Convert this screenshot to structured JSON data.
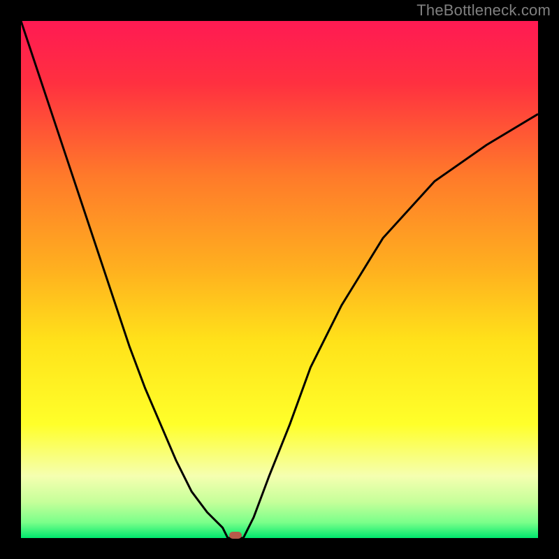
{
  "watermark": "TheBottleneck.com",
  "colors": {
    "frame": "#000000",
    "marker": "#b85a4a",
    "curve": "#000000",
    "gradient_stops": [
      {
        "offset": 0.0,
        "color": "#ff1a53"
      },
      {
        "offset": 0.12,
        "color": "#ff3040"
      },
      {
        "offset": 0.3,
        "color": "#ff7a2a"
      },
      {
        "offset": 0.48,
        "color": "#ffb01f"
      },
      {
        "offset": 0.62,
        "color": "#ffe21a"
      },
      {
        "offset": 0.78,
        "color": "#ffff2a"
      },
      {
        "offset": 0.88,
        "color": "#f5ffb0"
      },
      {
        "offset": 0.93,
        "color": "#c6ff9a"
      },
      {
        "offset": 0.97,
        "color": "#7aff8a"
      },
      {
        "offset": 1.0,
        "color": "#00e86e"
      }
    ]
  },
  "chart_data": {
    "type": "line",
    "title": "",
    "xlabel": "",
    "ylabel": "",
    "x": [
      0.0,
      0.03,
      0.06,
      0.09,
      0.12,
      0.15,
      0.18,
      0.21,
      0.24,
      0.27,
      0.3,
      0.33,
      0.36,
      0.39,
      0.4,
      0.43,
      0.45,
      0.48,
      0.52,
      0.56,
      0.62,
      0.7,
      0.8,
      0.9,
      1.0
    ],
    "y": [
      1.0,
      0.91,
      0.82,
      0.73,
      0.64,
      0.55,
      0.46,
      0.37,
      0.29,
      0.22,
      0.15,
      0.09,
      0.05,
      0.02,
      0.0,
      0.0,
      0.04,
      0.12,
      0.22,
      0.33,
      0.45,
      0.58,
      0.69,
      0.76,
      0.82
    ],
    "xlim": [
      0,
      1
    ],
    "ylim": [
      0,
      1
    ],
    "marker_point": {
      "x": 0.415,
      "y": 0.005
    }
  }
}
